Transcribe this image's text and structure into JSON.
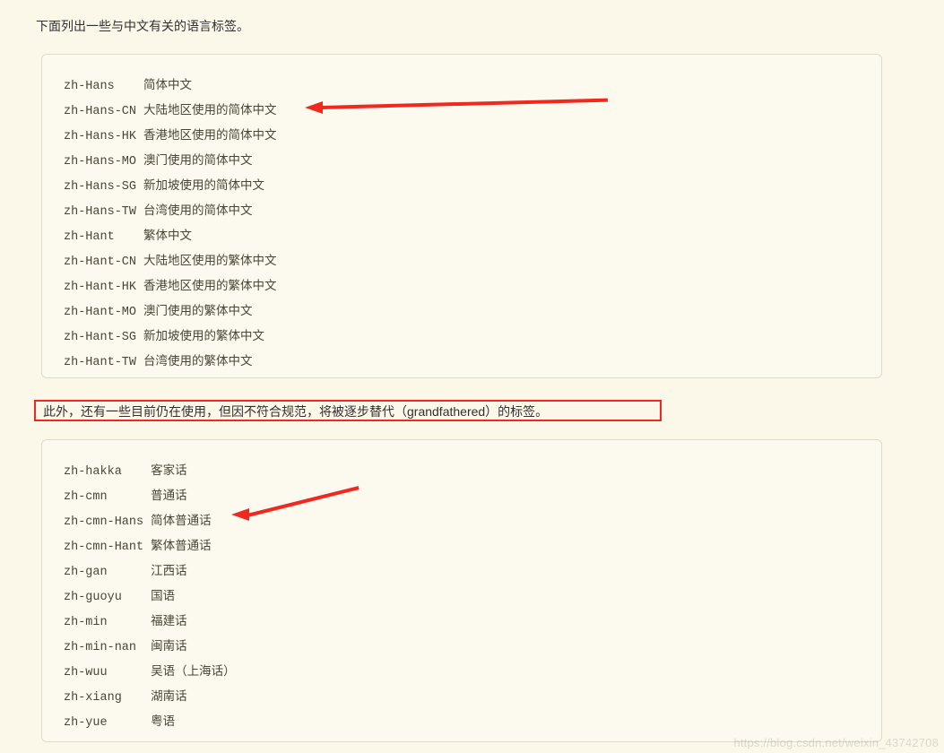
{
  "intro": "下面列出一些与中文有关的语言标签。",
  "middle": "此外，还有一些目前仍在使用，但因不符合规范，将被逐步替代（grandfathered）的标签。",
  "watermark": "https://blog.csdn.net/weixin_43742708",
  "block1": [
    {
      "tag": "zh-Hans",
      "pad": "zh-Hans   ",
      "desc": "简体中文"
    },
    {
      "tag": "zh-Hans-CN",
      "pad": "zh-Hans-CN",
      "desc": "大陆地区使用的简体中文"
    },
    {
      "tag": "zh-Hans-HK",
      "pad": "zh-Hans-HK",
      "desc": "香港地区使用的简体中文"
    },
    {
      "tag": "zh-Hans-MO",
      "pad": "zh-Hans-MO",
      "desc": "澳门使用的简体中文"
    },
    {
      "tag": "zh-Hans-SG",
      "pad": "zh-Hans-SG",
      "desc": "新加坡使用的简体中文"
    },
    {
      "tag": "zh-Hans-TW",
      "pad": "zh-Hans-TW",
      "desc": "台湾使用的简体中文"
    },
    {
      "tag": "zh-Hant",
      "pad": "zh-Hant   ",
      "desc": "繁体中文"
    },
    {
      "tag": "zh-Hant-CN",
      "pad": "zh-Hant-CN",
      "desc": "大陆地区使用的繁体中文"
    },
    {
      "tag": "zh-Hant-HK",
      "pad": "zh-Hant-HK",
      "desc": "香港地区使用的繁体中文"
    },
    {
      "tag": "zh-Hant-MO",
      "pad": "zh-Hant-MO",
      "desc": "澳门使用的繁体中文"
    },
    {
      "tag": "zh-Hant-SG",
      "pad": "zh-Hant-SG",
      "desc": "新加坡使用的繁体中文"
    },
    {
      "tag": "zh-Hant-TW",
      "pad": "zh-Hant-TW",
      "desc": "台湾使用的繁体中文"
    }
  ],
  "block2": [
    {
      "tag": "zh-hakka",
      "pad": "zh-hakka   ",
      "desc": "客家话"
    },
    {
      "tag": "zh-cmn",
      "pad": "zh-cmn     ",
      "desc": "普通话"
    },
    {
      "tag": "zh-cmn-Hans",
      "pad": "zh-cmn-Hans",
      "desc": "简体普通话"
    },
    {
      "tag": "zh-cmn-Hant",
      "pad": "zh-cmn-Hant",
      "desc": "繁体普通话"
    },
    {
      "tag": "zh-gan",
      "pad": "zh-gan     ",
      "desc": "江西话"
    },
    {
      "tag": "zh-guoyu",
      "pad": "zh-guoyu   ",
      "desc": "国语"
    },
    {
      "tag": "zh-min",
      "pad": "zh-min     ",
      "desc": "福建话"
    },
    {
      "tag": "zh-min-nan",
      "pad": "zh-min-nan ",
      "desc": "闽南话"
    },
    {
      "tag": "zh-wuu",
      "pad": "zh-wuu     ",
      "desc": "吴语（上海话）"
    },
    {
      "tag": "zh-xiang",
      "pad": "zh-xiang   ",
      "desc": "湖南话"
    },
    {
      "tag": "zh-yue",
      "pad": "zh-yue     ",
      "desc": "粤语"
    }
  ]
}
